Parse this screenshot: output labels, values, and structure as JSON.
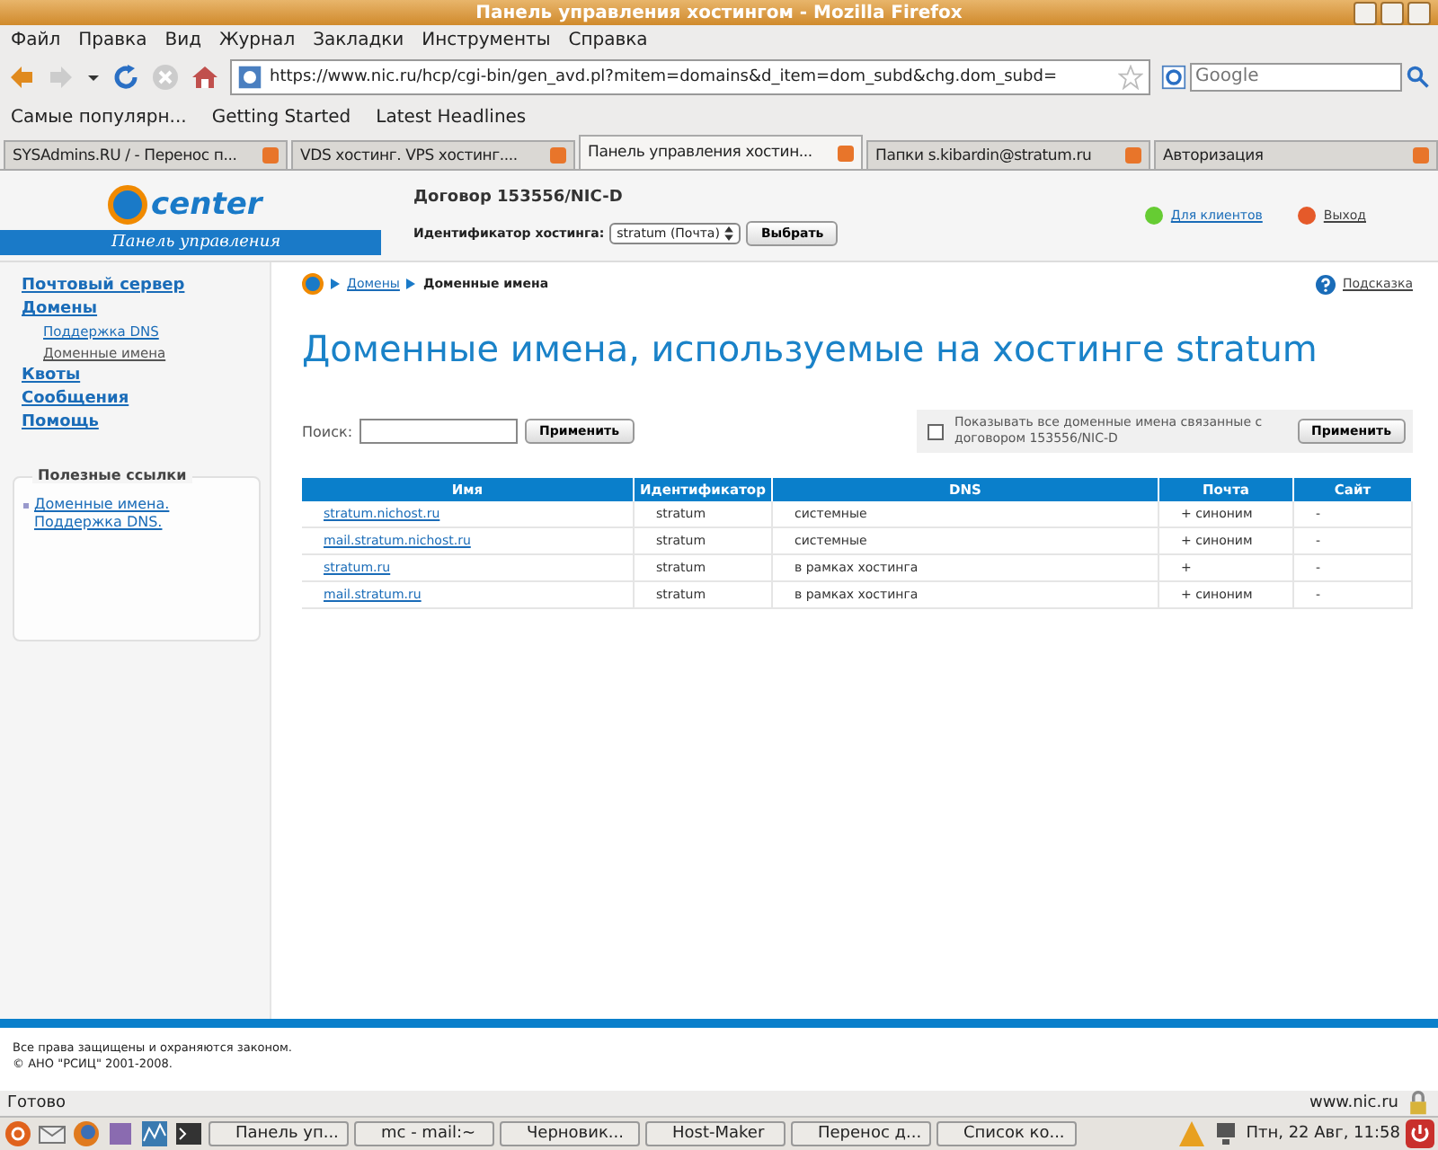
{
  "window": {
    "title": "Панель управления хостингом - Mozilla Firefox"
  },
  "menu": [
    "Файл",
    "Правка",
    "Вид",
    "Журнал",
    "Закладки",
    "Инструменты",
    "Справка"
  ],
  "navbar": {
    "url": "https://www.nic.ru/hcp/cgi-bin/gen_avd.pl?mitem=domains&d_item=dom_subd&chg.dom_subd=",
    "search_placeholder": "Google"
  },
  "bookmarks": [
    "Самые популярн...",
    "Getting Started",
    "Latest Headlines"
  ],
  "tabs": [
    {
      "label": "SYSAdmins.RU / - Перенос п...",
      "selected": false
    },
    {
      "label": "VDS хостинг. VPS хостинг....",
      "selected": false
    },
    {
      "label": "Панель управления хостин...",
      "selected": true
    },
    {
      "label": "Папки s.kibardin@stratum.ru",
      "selected": false
    },
    {
      "label": "Авторизация",
      "selected": false
    }
  ],
  "header": {
    "logo_word": "center",
    "logo_caption": "Панель управления",
    "contract": "Договор 153556/NIC-D",
    "hosting_label": "Идентификатор хостинга:",
    "hosting_value": "stratum (Почта)",
    "select_button": "Выбрать",
    "client_link": "Для клиентов",
    "logout_link": "Выход"
  },
  "sidebar": {
    "items": [
      {
        "label": "Почтовый сервер"
      },
      {
        "label": "Домены",
        "children": [
          {
            "label": "Поддержка DNS",
            "selected": false
          },
          {
            "label": "Доменные имена",
            "selected": true
          }
        ]
      },
      {
        "label": "Квоты"
      },
      {
        "label": "Сообщения"
      },
      {
        "label": "Помощь"
      }
    ],
    "links_title": "Полезные ссылки",
    "links": [
      "Доменные имена. Поддержка DNS."
    ]
  },
  "breadcrumb": {
    "link": "Домены",
    "current": "Доменные имена"
  },
  "help_link": "Подсказка",
  "heading": "Доменные имена, используемые на хостинге stratum",
  "search": {
    "label": "Поиск:",
    "button": "Применить"
  },
  "show_all": {
    "checked": false,
    "label": "Показывать все доменные имена связанные с договором 153556/NIC-D",
    "button": "Применить"
  },
  "table": {
    "columns": [
      "Имя",
      "Идентификатор",
      "DNS",
      "Почта",
      "Сайт"
    ],
    "rows": [
      [
        "stratum.nichost.ru",
        "stratum",
        "системные",
        "+ синоним",
        "-"
      ],
      [
        "mail.stratum.nichost.ru",
        "stratum",
        "системные",
        "+ синоним",
        "-"
      ],
      [
        "stratum.ru",
        "stratum",
        "в рамках хостинга",
        "+",
        "-"
      ],
      [
        "mail.stratum.ru",
        "stratum",
        "в рамках хостинга",
        "+ синоним",
        "-"
      ]
    ]
  },
  "footer": [
    "Все права защищены и охраняются законом.",
    "© АНО \"РСИЦ\" 2001-2008."
  ],
  "status_bar": {
    "text": "Готово",
    "host": "www.nic.ru"
  },
  "taskbar": {
    "items": [
      "Панель уп...",
      "mc - mail:~",
      "Черновик...",
      "Host-Maker",
      "Перенос д...",
      "Список ко..."
    ],
    "clock": "Птн, 22 Авг, 11:58"
  }
}
